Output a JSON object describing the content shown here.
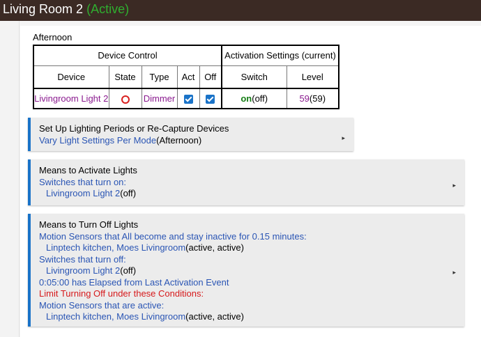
{
  "header": {
    "title": "Living Room 2",
    "status": "(Active)"
  },
  "period": "Afternoon",
  "table": {
    "group_device": "Device Control",
    "group_activation": "Activation Settings (current)",
    "columns": {
      "device": "Device",
      "state": "State",
      "type": "Type",
      "act": "Act",
      "off": "Off",
      "switch": "Switch",
      "level": "Level"
    },
    "row": {
      "device": "Livingroom Light 2",
      "type": "Dimmer",
      "switch_on": "on",
      "switch_current": "(off)",
      "level": "59",
      "level_current": "(59)",
      "act_checked": true,
      "off_checked": true
    }
  },
  "card1": {
    "title": "Set Up Lighting Periods or Re-Capture Devices",
    "link": "Vary Light Settings Per Mode",
    "link_suffix": "(Afternoon)"
  },
  "card2": {
    "title": "Means to Activate Lights",
    "link": "Switches that turn on:",
    "device": "Livingroom Light 2",
    "device_state": "(off)"
  },
  "card3": {
    "title": "Means to Turn Off Lights",
    "motion_line": "Motion Sensors that All become and stay inactive for 0.15 minutes:",
    "motion_devices": "Linptech kitchen, Moes Livingroom",
    "motion_states": "(active, active)",
    "switches_line": "Switches that turn off:",
    "switch_device": "Livingroom Light 2",
    "switch_state": "(off)",
    "elapsed_line": "0:05:00 has Elapsed from Last Activation Event",
    "limit_line": "Limit Turning Off under these Conditions:",
    "active_line": "Motion Sensors that are active:",
    "active_devices": "Linptech kitchen, Moes Livingroom",
    "active_states": "(active, active)"
  },
  "icons": {
    "expand": "▸",
    "state": "red-circle-icon",
    "checkbox": "checkbox-checked-icon"
  },
  "colors": {
    "topbar": "#3b2a24",
    "active_status": "#2fae2f",
    "accent": "#1a73c8",
    "link": "#2a55b4",
    "warning": "#d6191b",
    "device_purple": "#8a1a8f",
    "on_green": "#157d15"
  }
}
